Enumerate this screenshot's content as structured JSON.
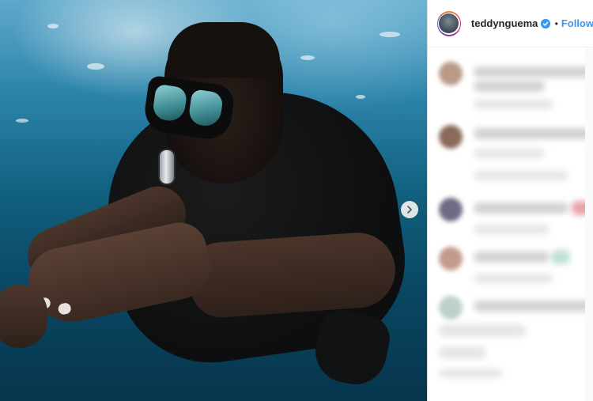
{
  "post": {
    "username": "teddynguema",
    "separator": "•",
    "follow_label": "Follow",
    "verified": true,
    "verified_color": "#3897f0",
    "follow_color": "#3897f0"
  },
  "photo": {
    "subject": "underwater diver with snorkel mask",
    "carousel_next_icon": "chevron-right-icon"
  },
  "comments": {
    "blurred": true
  }
}
